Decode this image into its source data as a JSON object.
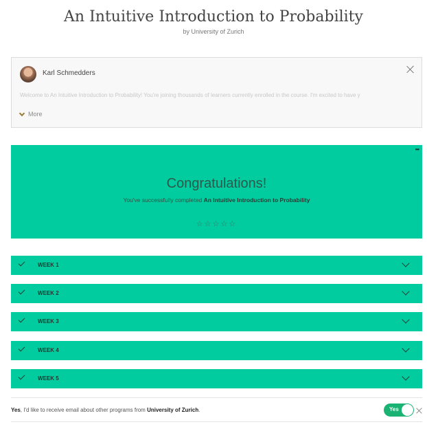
{
  "course": {
    "title": "An Intuitive Introduction to Probability",
    "byline": "by University of Zurich"
  },
  "instructor_message": {
    "name": "Karl Schmedders",
    "preview": "Welcome to An Intuitive Introduction to Probability! You're joining thousands of learners currently enrolled in the course. I'm excited to have y",
    "more_label": "More",
    "icons": {
      "avatar": "instructor-avatar",
      "close": "close-icon",
      "expand": "chevron-down-icon"
    }
  },
  "completion": {
    "title": "Congratulations!",
    "message_prefix": "You've successfully completed",
    "course_name": "An Intuitive Introduction to Probability",
    "menu_glyph": "•••",
    "rating_glyph": "☆",
    "rating": {
      "value": 0,
      "max": 5
    }
  },
  "weeks": [
    {
      "label": "WEEK 1",
      "completed": true
    },
    {
      "label": "WEEK 2",
      "completed": true
    },
    {
      "label": "WEEK 3",
      "completed": true
    },
    {
      "label": "WEEK 4",
      "completed": true
    },
    {
      "label": "WEEK 5",
      "completed": true
    }
  ],
  "email_consent": {
    "yes_prefix": "Yes",
    "text_middle": ", I'd like to receive email about other programs from",
    "institution": "University of Zurich",
    "period": ".",
    "toggle_label": "Yes",
    "toggle_on": true
  },
  "colors": {
    "accent_green": "#00cc9f",
    "toggle_green": "#1ab373",
    "star_outline": "#3c7562"
  }
}
